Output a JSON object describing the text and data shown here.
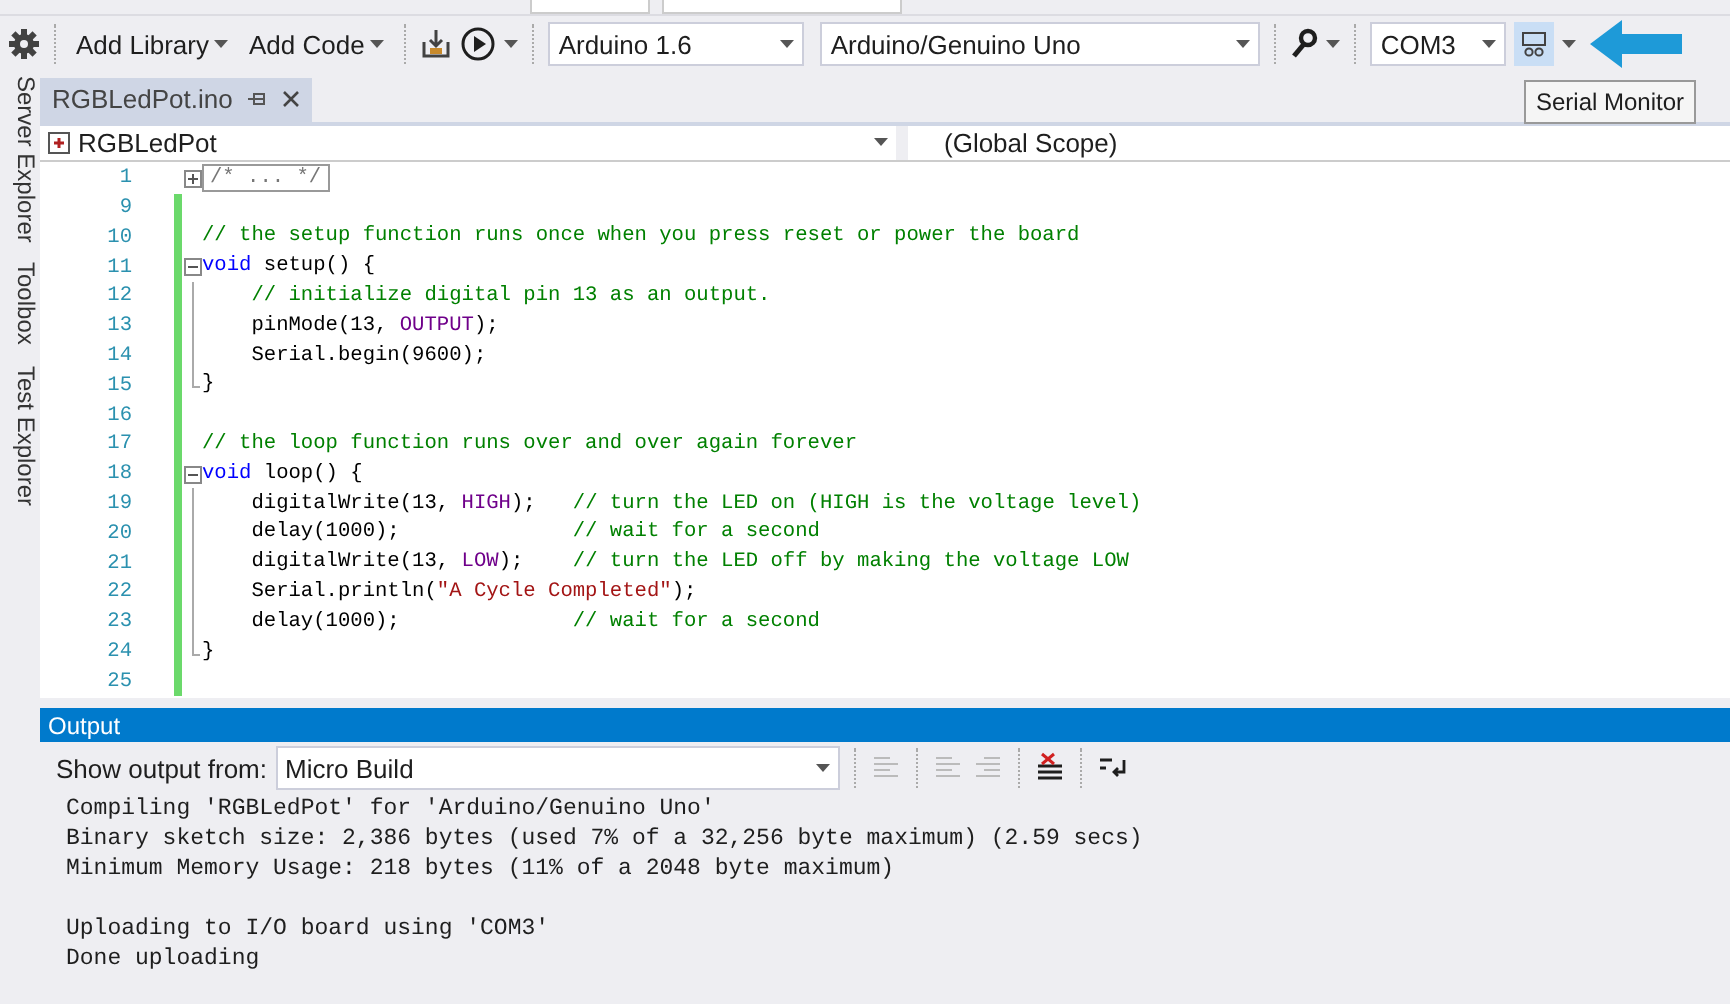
{
  "toolbar": {
    "buttons": [
      {
        "label": "Add Library"
      },
      {
        "label": "Add Code"
      }
    ],
    "version_select": {
      "value": "Arduino 1.6"
    },
    "board_select": {
      "value": "Arduino/Genuino Uno"
    },
    "port_select": {
      "value": "COM3"
    },
    "tooltip": "Serial Monitor"
  },
  "side_tabs": [
    {
      "label": "Server Explorer"
    },
    {
      "label": "Toolbox"
    },
    {
      "label": "Test Explorer"
    }
  ],
  "tabs": [
    {
      "label": "RGBLedPot.ino",
      "selected": true
    }
  ],
  "nav": {
    "scope_left": "RGBLedPot",
    "scope_right": "(Global Scope)"
  },
  "code": [
    {
      "number": "1",
      "kind": "collapsed",
      "changed": false,
      "tokens": [
        {
          "kind": "collapsed",
          "text": "/* ... */"
        }
      ]
    },
    {
      "number": "9",
      "kind": "plain",
      "changed": true
    },
    {
      "number": "10",
      "kind": "plain",
      "changed": true,
      "tokens": [
        {
          "kind": "comment",
          "text": "// the setup function runs once when you press reset or power the board"
        }
      ]
    },
    {
      "number": "11",
      "kind": "fold-start",
      "changed": true,
      "tokens": [
        {
          "kind": "keyword",
          "text": "void"
        },
        {
          "kind": "plain",
          "text": " setup() {"
        }
      ]
    },
    {
      "number": "12",
      "kind": "fold-body",
      "changed": true,
      "tokens": [
        {
          "kind": "comment",
          "text": "    // initialize digital pin 13 as an output."
        }
      ]
    },
    {
      "number": "13",
      "kind": "fold-body",
      "changed": true,
      "tokens": [
        {
          "kind": "plain",
          "text": "    pinMode(13, "
        },
        {
          "kind": "macro",
          "text": "OUTPUT"
        },
        {
          "kind": "plain",
          "text": ");"
        }
      ]
    },
    {
      "number": "14",
      "kind": "fold-body",
      "changed": true,
      "tokens": [
        {
          "kind": "plain",
          "text": "    Serial.begin(9600);"
        }
      ]
    },
    {
      "number": "15",
      "kind": "fold-end",
      "changed": true,
      "tokens": [
        {
          "kind": "plain",
          "text": "}"
        }
      ]
    },
    {
      "number": "16",
      "kind": "plain",
      "changed": true
    },
    {
      "number": "17",
      "kind": "plain",
      "changed": true,
      "tokens": [
        {
          "kind": "comment",
          "text": "// the loop function runs over and over again forever"
        }
      ]
    },
    {
      "number": "18",
      "kind": "fold-start",
      "changed": true,
      "tokens": [
        {
          "kind": "keyword",
          "text": "void"
        },
        {
          "kind": "plain",
          "text": " loop() {"
        }
      ]
    },
    {
      "number": "19",
      "kind": "fold-body",
      "changed": true,
      "tokens": [
        {
          "kind": "plain",
          "text": "    digitalWrite(13, "
        },
        {
          "kind": "macro",
          "text": "HIGH"
        },
        {
          "kind": "plain",
          "text": ");   "
        },
        {
          "kind": "comment",
          "text": "// turn the LED on (HIGH is the voltage level)"
        }
      ]
    },
    {
      "number": "20",
      "kind": "fold-body",
      "changed": true,
      "tokens": [
        {
          "kind": "plain",
          "text": "    delay(1000);              "
        },
        {
          "kind": "comment",
          "text": "// wait for a second"
        }
      ]
    },
    {
      "number": "21",
      "kind": "fold-body",
      "changed": true,
      "tokens": [
        {
          "kind": "plain",
          "text": "    digitalWrite(13, "
        },
        {
          "kind": "macro",
          "text": "LOW"
        },
        {
          "kind": "plain",
          "text": ");    "
        },
        {
          "kind": "comment",
          "text": "// turn the LED off by making the voltage LOW"
        }
      ]
    },
    {
      "number": "22",
      "kind": "fold-body",
      "changed": true,
      "tokens": [
        {
          "kind": "plain",
          "text": "    Serial.println("
        },
        {
          "kind": "string",
          "text": "\"A Cycle Completed\""
        },
        {
          "kind": "plain",
          "text": ");"
        }
      ]
    },
    {
      "number": "23",
      "kind": "fold-body",
      "changed": true,
      "tokens": [
        {
          "kind": "plain",
          "text": "    delay(1000);              "
        },
        {
          "kind": "comment",
          "text": "// wait for a second"
        }
      ]
    },
    {
      "number": "24",
      "kind": "fold-end",
      "changed": true,
      "tokens": [
        {
          "kind": "plain",
          "text": "}"
        }
      ]
    },
    {
      "number": "25",
      "kind": "plain",
      "changed": true
    }
  ],
  "output": {
    "title": "Output",
    "source_label": "Show output from:",
    "source_value": "Micro Build",
    "blocks": [
      [
        "Compiling 'RGBLedPot' for 'Arduino/Genuino Uno'",
        "Binary sketch size: 2,386 bytes (used 7% of a 32,256 byte maximum) (2.59 secs)",
        "Minimum Memory Usage: 218 bytes (11% of a 2048 byte maximum)"
      ],
      [
        "Uploading to I/O board using 'COM3'",
        "Done uploading"
      ]
    ]
  }
}
